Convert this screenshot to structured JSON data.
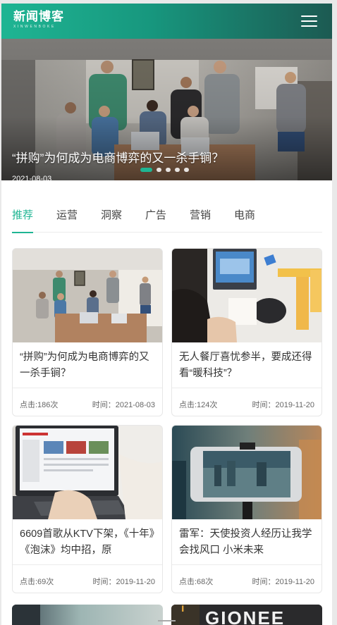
{
  "header": {
    "logo_cn": "新闻博客",
    "logo_en": "XINWENBOKE",
    "menu_icon": "hamburger-menu-icon"
  },
  "banner": {
    "title": "“拼购”为何成为电商博弈的又一杀手锏？",
    "date": "2021-08-03",
    "slide_count": 5,
    "active_slide": 1
  },
  "tabs": [
    {
      "label": "推荐",
      "active": true
    },
    {
      "label": "运营",
      "active": false
    },
    {
      "label": "洞察",
      "active": false
    },
    {
      "label": "广告",
      "active": false
    },
    {
      "label": "营销",
      "active": false
    },
    {
      "label": "电商",
      "active": false
    }
  ],
  "articles": [
    {
      "title": "“拼购”为何成为电商博弈的又一杀手锏？",
      "views": "点击:186次",
      "time": "时间：2021-08-03"
    },
    {
      "title": "无人餐厅喜忧参半，要成还得看“暖科技”？",
      "views": "点击:124次",
      "time": "时间：2019-11-20"
    },
    {
      "title": "6609首歌从KTV下架，《十年》《泡沫》均中招，原",
      "views": "点击:69次",
      "time": "时间：2019-11-20"
    },
    {
      "title": "雷军：天使投资人经历让我学会找风口 小米未来",
      "views": "点击:68次",
      "time": "时间：2019-11-20"
    }
  ],
  "peek_cards": [
    {
      "image": "office-photo"
    },
    {
      "image": "gionee-sign-photo",
      "sign_text": "GIONEE"
    }
  ],
  "colors": {
    "accent": "#1fb593",
    "header_gradient": [
      "#1fb593",
      "#17977e",
      "#1c5a52"
    ]
  }
}
